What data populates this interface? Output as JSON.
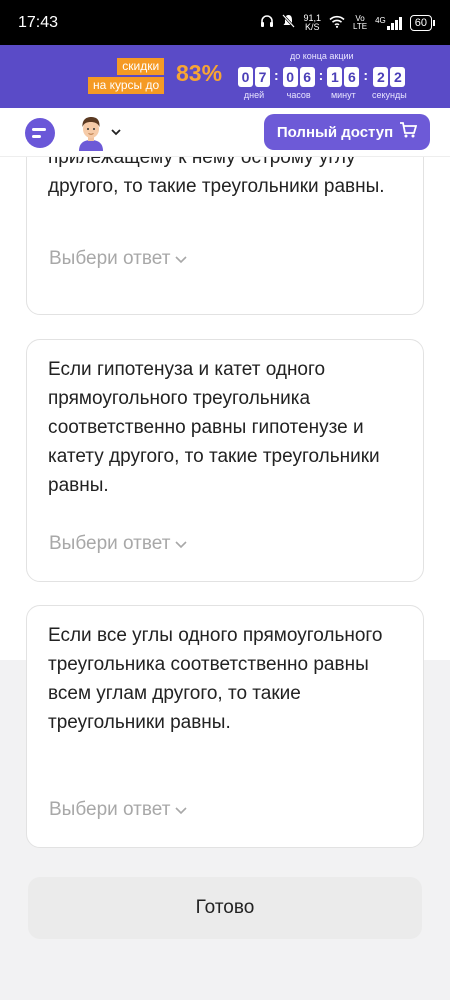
{
  "status_bar": {
    "time": "17:43",
    "speed": "91,1",
    "speed_unit": "K/S",
    "net_top": "Vo",
    "net_bottom": "LTE",
    "gen": "4G",
    "battery": "60"
  },
  "promo": {
    "tag1": "скидки",
    "tag2": "на курсы до",
    "percent": "83%",
    "until": "до конца акции",
    "timer": [
      {
        "d1": "0",
        "d2": "7",
        "label": "дней"
      },
      {
        "d1": "0",
        "d2": "6",
        "label": "часов"
      },
      {
        "d1": "1",
        "d2": "6",
        "label": "минут"
      },
      {
        "d1": "2",
        "d2": "2",
        "label": "секунды"
      }
    ],
    "accent": "#f59a24",
    "background": "#5a4bc7"
  },
  "header": {
    "full_access": "Полный доступ",
    "accent": "#6d5ad7"
  },
  "cards": [
    {
      "text": "прилежащему к нему острому углу другого, то такие треугольники равны.",
      "choose": "Выбери ответ"
    },
    {
      "text": "Если гипотенуза и катет одного прямоугольного треугольника соответственно равны гипотенузе и катету другого, то такие треугольники равны.",
      "choose": "Выбери ответ"
    },
    {
      "text": "Если все углы одного прямоугольного треугольника соответственно равны всем углам другого, то такие треугольники равны.",
      "choose": "Выбери ответ"
    }
  ],
  "done_button": "Готово"
}
